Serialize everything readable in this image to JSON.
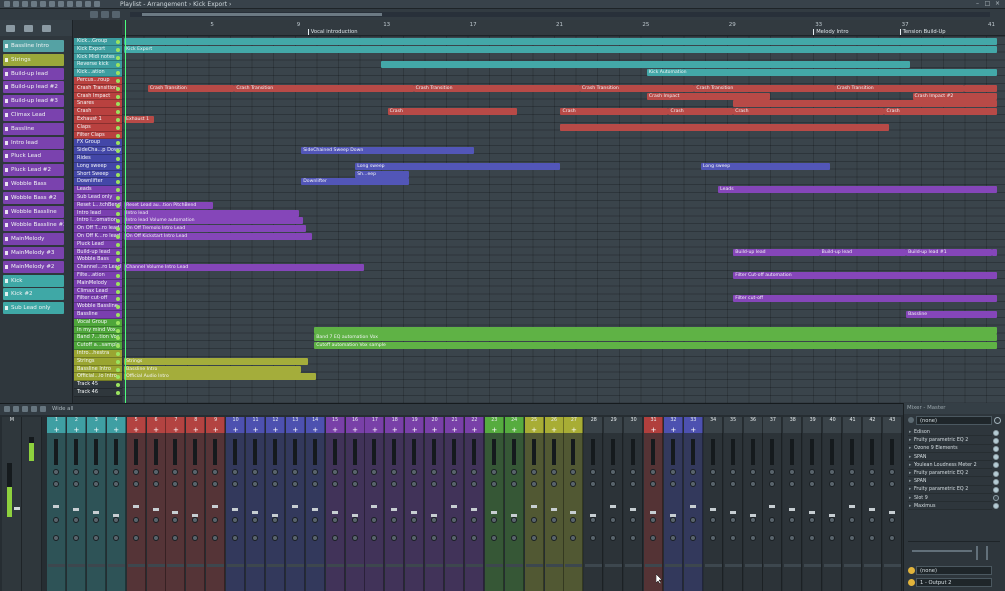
{
  "window": {
    "breadcrumb": "Playlist - Arrangement › Kick Export ›"
  },
  "picker": {
    "items": [
      {
        "label": "Bassline Intro",
        "color": "#55a2a4"
      },
      {
        "label": "Strings",
        "color": "#9aa83a"
      },
      {
        "label": "Build-up lead",
        "color": "#7a42ae"
      },
      {
        "label": "Build-up lead #2",
        "color": "#7a42ae"
      },
      {
        "label": "Build-up lead #3",
        "color": "#7a42ae"
      },
      {
        "label": "Climax Lead",
        "color": "#7a42ae"
      },
      {
        "label": "Bassline",
        "color": "#7a42ae"
      },
      {
        "label": "Intro lead",
        "color": "#7a42ae"
      },
      {
        "label": "Pluck Lead",
        "color": "#7a42ae"
      },
      {
        "label": "Pluck Lead #2",
        "color": "#7a42ae"
      },
      {
        "label": "Wobble Bass",
        "color": "#7a42ae"
      },
      {
        "label": "Wobble Bass #2",
        "color": "#7a42ae"
      },
      {
        "label": "Wobble Bassline",
        "color": "#7a42ae"
      },
      {
        "label": "Wobble Bassline #2",
        "color": "#7a42ae"
      },
      {
        "label": "MainMelody",
        "color": "#7a42ae"
      },
      {
        "label": "MainMelody #3",
        "color": "#7a42ae"
      },
      {
        "label": "MainMelody #2",
        "color": "#7a42ae"
      },
      {
        "label": "Kick",
        "color": "#3fa8a6"
      },
      {
        "label": "Kick #2",
        "color": "#3fa8a6"
      },
      {
        "label": "Sub Lead only",
        "color": "#3fa8a6"
      }
    ]
  },
  "tracks": [
    {
      "label": "Kick...Group",
      "color": "#3d9ea0"
    },
    {
      "label": "Kick Export",
      "color": "#3d9ea0"
    },
    {
      "label": "Kick Midi notes",
      "color": "#3d9ea0"
    },
    {
      "label": "Reverse kick",
      "color": "#3d9ea0"
    },
    {
      "label": "Kick...ation",
      "color": "#3d9ea0"
    },
    {
      "label": "Percus...roup",
      "color": "#b9413f"
    },
    {
      "label": "Crash Transition",
      "color": "#b9413f"
    },
    {
      "label": "Crash Impact",
      "color": "#b9413f"
    },
    {
      "label": "Snares",
      "color": "#b9413f"
    },
    {
      "label": "Crash",
      "color": "#b9413f"
    },
    {
      "label": "Exhaust 1",
      "color": "#b9413f"
    },
    {
      "label": "Claps",
      "color": "#b9413f"
    },
    {
      "label": "Filter Claps",
      "color": "#b9413f"
    },
    {
      "label": "FX Group",
      "color": "#4347a8"
    },
    {
      "label": "SideCha...p Down",
      "color": "#4347a8"
    },
    {
      "label": "Rides",
      "color": "#4347a8"
    },
    {
      "label": "Long sweep",
      "color": "#4347a8"
    },
    {
      "label": "Short Sweep",
      "color": "#4347a8"
    },
    {
      "label": "Downlifter",
      "color": "#4347a8"
    },
    {
      "label": "Leads",
      "color": "#7a3fb0"
    },
    {
      "label": "Sub Lead only",
      "color": "#7a3fb0"
    },
    {
      "label": "Reset L...tchBend",
      "color": "#7a3fb0"
    },
    {
      "label": "Intro lead",
      "color": "#7a3fb0"
    },
    {
      "label": "Intro l...omation",
      "color": "#7a3fb0"
    },
    {
      "label": "On Off T...ro lead",
      "color": "#7a3fb0"
    },
    {
      "label": "On Off K...ro lead",
      "color": "#7a3fb0"
    },
    {
      "label": "Pluck Lead",
      "color": "#7a3fb0"
    },
    {
      "label": "Build-up lead",
      "color": "#7a3fb0"
    },
    {
      "label": "Wobble Bass",
      "color": "#7a3fb0"
    },
    {
      "label": "Channel...ro Lead",
      "color": "#7a3fb0"
    },
    {
      "label": "Filte...ation",
      "color": "#7a3fb0"
    },
    {
      "label": "MainMelody",
      "color": "#7a3fb0"
    },
    {
      "label": "Climax Lead",
      "color": "#7a3fb0"
    },
    {
      "label": "Filter cut-off",
      "color": "#7a3fb0"
    },
    {
      "label": "Wobble Bassline",
      "color": "#7a3fb0"
    },
    {
      "label": "Bassline",
      "color": "#7a3fb0"
    },
    {
      "label": "Vocal Group",
      "color": "#4ea63a"
    },
    {
      "label": "In my mind Vox",
      "color": "#4ea63a"
    },
    {
      "label": "Band 7...tion Vox",
      "color": "#4ea63a"
    },
    {
      "label": "Cutoff a...sample",
      "color": "#4ea63a"
    },
    {
      "label": "Intro...hestra",
      "color": "#9aa531"
    },
    {
      "label": "Strings",
      "color": "#9aa531"
    },
    {
      "label": "Bassline Intro",
      "color": "#9aa531"
    },
    {
      "label": "Official...io Intro",
      "color": "#9aa531"
    },
    {
      "label": "Track 45",
      "color": "#2f373c"
    },
    {
      "label": "Track 46",
      "color": "#2f373c"
    }
  ],
  "ruler": {
    "numbers": [
      "5",
      "9",
      "13",
      "17",
      "21",
      "25",
      "29",
      "33",
      "37",
      "41"
    ],
    "markers": [
      {
        "label": "Vocal introduction",
        "bar": 9.6
      },
      {
        "label": "Melody Intro",
        "bar": 33
      },
      {
        "label": "Tension Build-Up",
        "bar": 37
      }
    ]
  },
  "clips": [
    {
      "row": 0,
      "start": 0.1,
      "end": 40.5,
      "label": "",
      "color": "#43a8a8"
    },
    {
      "row": 1,
      "start": 0.1,
      "end": 40.5,
      "label": "Kick Export",
      "color": "#43a8a8"
    },
    {
      "row": 3,
      "start": 12,
      "end": 36.5,
      "label": "",
      "color": "#43a8a8"
    },
    {
      "row": 4,
      "start": 24.3,
      "end": 40.5,
      "label": "Kick Automation",
      "color": "#43a8a8"
    },
    {
      "row": 6,
      "start": 1.2,
      "end": 5.2,
      "label": "Crash Transition",
      "color": "#b84a47"
    },
    {
      "row": 6,
      "start": 5.2,
      "end": 13.5,
      "label": "Crash Transition",
      "color": "#b84a47"
    },
    {
      "row": 6,
      "start": 13.5,
      "end": 21.2,
      "label": "Crash Transition",
      "color": "#b84a47"
    },
    {
      "row": 6,
      "start": 21.2,
      "end": 26.5,
      "label": "Crash Transition",
      "color": "#b84a47"
    },
    {
      "row": 6,
      "start": 26.5,
      "end": 33,
      "label": "Crash Transition",
      "color": "#b84a47"
    },
    {
      "row": 6,
      "start": 33,
      "end": 39,
      "label": "Crash Transition",
      "color": "#b84a47"
    },
    {
      "row": 6,
      "start": 39,
      "end": 40.5,
      "label": "",
      "color": "#b84a47"
    },
    {
      "row": 7,
      "start": 24.3,
      "end": 30,
      "label": "Crash Impact",
      "color": "#b84a47"
    },
    {
      "row": 7,
      "start": 36.6,
      "end": 40.5,
      "label": "Crash Impact #2",
      "color": "#b84a47"
    },
    {
      "row": 8,
      "start": 28.3,
      "end": 40.5,
      "label": "",
      "color": "#b84a47"
    },
    {
      "row": 9,
      "start": 12.3,
      "end": 18.3,
      "label": "Crash",
      "color": "#b84a47"
    },
    {
      "row": 9,
      "start": 20.3,
      "end": 25.3,
      "label": "Crash",
      "color": "#b84a47"
    },
    {
      "row": 9,
      "start": 25.3,
      "end": 28.3,
      "label": "Crash",
      "color": "#b84a47"
    },
    {
      "row": 9,
      "start": 28.3,
      "end": 35.3,
      "label": "Crash",
      "color": "#b84a47"
    },
    {
      "row": 9,
      "start": 35.3,
      "end": 40.5,
      "label": "Crash",
      "color": "#b84a47"
    },
    {
      "row": 10,
      "start": 0.1,
      "end": 1.5,
      "label": "Exhaust 1",
      "color": "#b84a47"
    },
    {
      "row": 11,
      "start": 20.3,
      "end": 35.5,
      "label": "",
      "color": "#b84a47"
    },
    {
      "row": 14,
      "start": 8.3,
      "end": 16.3,
      "label": "SideChained Sweep Down",
      "color": "#5256b8"
    },
    {
      "row": 16,
      "start": 10.8,
      "end": 20.3,
      "label": "Long sweep",
      "color": "#5256b8"
    },
    {
      "row": 16,
      "start": 26.8,
      "end": 32.8,
      "label": "Long sweep",
      "color": "#5256b8"
    },
    {
      "row": 17,
      "start": 10.8,
      "end": 13.3,
      "label": "Sh...eep",
      "color": "#5256b8"
    },
    {
      "row": 18,
      "start": 8.3,
      "end": 13.3,
      "label": "Downlifter",
      "color": "#5256b8"
    },
    {
      "row": 21,
      "start": 0.1,
      "end": 4.2,
      "label": "Reset Lead au...tion PitchBend",
      "color": "#8546b9"
    },
    {
      "row": 22,
      "start": 0.1,
      "end": 8.2,
      "label": "Intro lead",
      "color": "#8546b9"
    },
    {
      "row": 23,
      "start": 0.1,
      "end": 8.4,
      "label": "Intro lead Volume automation",
      "color": "#8546b9"
    },
    {
      "row": 24,
      "start": 0.1,
      "end": 8.5,
      "label": "On Off Tremolo Intro Lead",
      "color": "#8546b9"
    },
    {
      "row": 25,
      "start": 0.1,
      "end": 8.8,
      "label": "On Off Kickstart Intro Lead",
      "color": "#8546b9"
    },
    {
      "row": 19,
      "start": 27.6,
      "end": 40.5,
      "label": "Leads",
      "color": "#8546b9"
    },
    {
      "row": 27,
      "start": 28.3,
      "end": 32.3,
      "label": "Build-up lead",
      "color": "#8546b9"
    },
    {
      "row": 27,
      "start": 32.3,
      "end": 36.3,
      "label": "Build-up lead",
      "color": "#8546b9"
    },
    {
      "row": 27,
      "start": 36.3,
      "end": 40.3,
      "label": "Build-up lead #1",
      "color": "#8546b9"
    },
    {
      "row": 27,
      "start": 40.3,
      "end": 40.5,
      "label": "",
      "color": "#8546b9"
    },
    {
      "row": 29,
      "start": 0.1,
      "end": 11.2,
      "label": "Channel Volume Intro Lead",
      "color": "#8546b9"
    },
    {
      "row": 30,
      "start": 28.3,
      "end": 40.5,
      "label": "Filter Cut-off automation",
      "color": "#8546b9"
    },
    {
      "row": 33,
      "start": 28.3,
      "end": 40.5,
      "label": "Filter cut-off",
      "color": "#8546b9"
    },
    {
      "row": 35,
      "start": 36.3,
      "end": 40.5,
      "label": "Bassline",
      "color": "#8546b9"
    },
    {
      "row": 37,
      "start": 8.9,
      "end": 40.5,
      "label": "",
      "color": "#5fb245"
    },
    {
      "row": 38,
      "start": 8.9,
      "end": 40.5,
      "label": "Band 7 EQ automation Vox",
      "color": "#5fb245"
    },
    {
      "row": 39,
      "start": 8.9,
      "end": 40.5,
      "label": "Cutoff automation Vox sample",
      "color": "#5fb245"
    },
    {
      "row": 41,
      "start": 0.1,
      "end": 8.6,
      "label": "Strings",
      "color": "#a4ad3b"
    },
    {
      "row": 42,
      "start": 0.1,
      "end": 8.3,
      "label": "Bassline Intro",
      "color": "#a4ad3b"
    },
    {
      "row": 43,
      "start": 0.1,
      "end": 9,
      "label": "Official Audio Intro",
      "color": "#a4ad3b"
    }
  ],
  "mixer": {
    "mode_label": "Wide all",
    "channel_numbers": [
      "1",
      "2",
      "3",
      "4",
      "5",
      "6",
      "7",
      "8",
      "9",
      "10",
      "11",
      "12",
      "13",
      "14",
      "15",
      "16",
      "17",
      "18",
      "19",
      "20",
      "21",
      "22",
      "23",
      "24",
      "25",
      "26",
      "27",
      "28",
      "29",
      "30",
      "31",
      "32",
      "33",
      "34",
      "35",
      "36",
      "37",
      "38",
      "39",
      "40",
      "41",
      "42",
      "43"
    ],
    "colors": [
      "#3f9fa3",
      "#3f9fa3",
      "#3f9fa3",
      "#3f9fa3",
      "#b34341",
      "#b34341",
      "#b34341",
      "#b34341",
      "#b34341",
      "#4d51b0",
      "#4d51b0",
      "#4d51b0",
      "#4d51b0",
      "#4d51b0",
      "#7940a8",
      "#7940a8",
      "#7940a8",
      "#7940a8",
      "#7940a8",
      "#7940a8",
      "#7940a8",
      "#7940a8",
      "#56ac3f",
      "#56ac3f",
      "#a8ad35",
      "#a8ad35",
      "#a8ad35",
      "#3a4349",
      "#3a4349",
      "#3a4349",
      "#b13f3d",
      "#4d51b0",
      "#4d51b0",
      "#3a4349",
      "#3a4349",
      "#3a4349",
      "#3a4349",
      "#3a4349",
      "#3a4349",
      "#3a4349",
      "#3a4349",
      "#3a4349",
      "#3a4349"
    ],
    "panel": {
      "header": "Mixer - Master",
      "input": "(none)",
      "effects": [
        "Edison",
        "Fruity parametric EQ 2",
        "Ozone 9 Elements",
        "SPAN",
        "Youlean Loudness Meter 2",
        "Fruity parametric EQ 2",
        "SPAN",
        "Fruity parametric EQ 2",
        "Slot 9",
        "Maximus"
      ],
      "send": "(none)",
      "output": "1 - Output 2"
    }
  }
}
